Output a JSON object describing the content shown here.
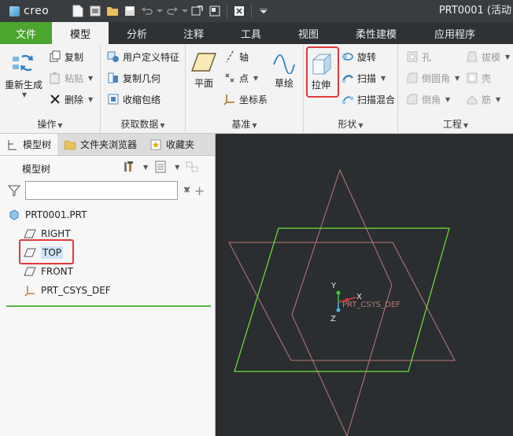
{
  "app": {
    "logo_text": "creo",
    "window_title": "PRT0001 (活动"
  },
  "quick_access": [
    {
      "name": "new-icon"
    },
    {
      "name": "open-icon"
    },
    {
      "name": "folder-icon"
    },
    {
      "name": "save-icon"
    },
    {
      "name": "undo-icon"
    },
    {
      "name": "redo-icon"
    },
    {
      "name": "regenerate-icon"
    },
    {
      "name": "windows-icon"
    },
    {
      "name": "close-window-icon"
    },
    {
      "name": "customize-icon"
    }
  ],
  "tabs": [
    {
      "label": "文件"
    },
    {
      "label": "模型"
    },
    {
      "label": "分析"
    },
    {
      "label": "注释"
    },
    {
      "label": "工具"
    },
    {
      "label": "视图"
    },
    {
      "label": "柔性建模"
    },
    {
      "label": "应用程序"
    }
  ],
  "ribbon": {
    "operations": {
      "label": "操作",
      "regenerate": "重新生成",
      "copy": "复制",
      "paste": "粘贴",
      "delete": "删除"
    },
    "get_data": {
      "label": "获取数据",
      "udf": "用户定义特征",
      "copy_geom": "复制几何",
      "shrinkwrap": "收缩包络"
    },
    "datum": {
      "label": "基准",
      "plane": "平面",
      "axis": "轴",
      "point": "点",
      "csys": "坐标系",
      "sketch": "草绘"
    },
    "shapes": {
      "label": "形状",
      "extrude": "拉伸",
      "revolve": "旋转",
      "sweep": "扫描",
      "swept_blend": "扫描混合"
    },
    "engineering": {
      "label": "工程",
      "hole": "孔",
      "round": "倒圆角",
      "chamfer": "倒角",
      "draft": "拔模",
      "shell": "壳",
      "rib": "筋"
    }
  },
  "panel": {
    "tabs": [
      {
        "label": "模型树"
      },
      {
        "label": "文件夹浏览器"
      },
      {
        "label": "收藏夹"
      }
    ],
    "tree_title": "模型树",
    "search_value": "",
    "items": [
      {
        "label": "PRT0001.PRT"
      },
      {
        "label": "RIGHT"
      },
      {
        "label": "TOP"
      },
      {
        "label": "FRONT"
      },
      {
        "label": "PRT_CSYS_DEF"
      }
    ]
  },
  "viewport": {
    "csys_label": "PRT_CSYS_DEF",
    "axis_x": "X",
    "axis_y": "Y",
    "axis_z": "Z",
    "colors": {
      "background": "#2b2e30",
      "top_plane": "#6fe33a",
      "other_planes": "#b8787a"
    }
  }
}
